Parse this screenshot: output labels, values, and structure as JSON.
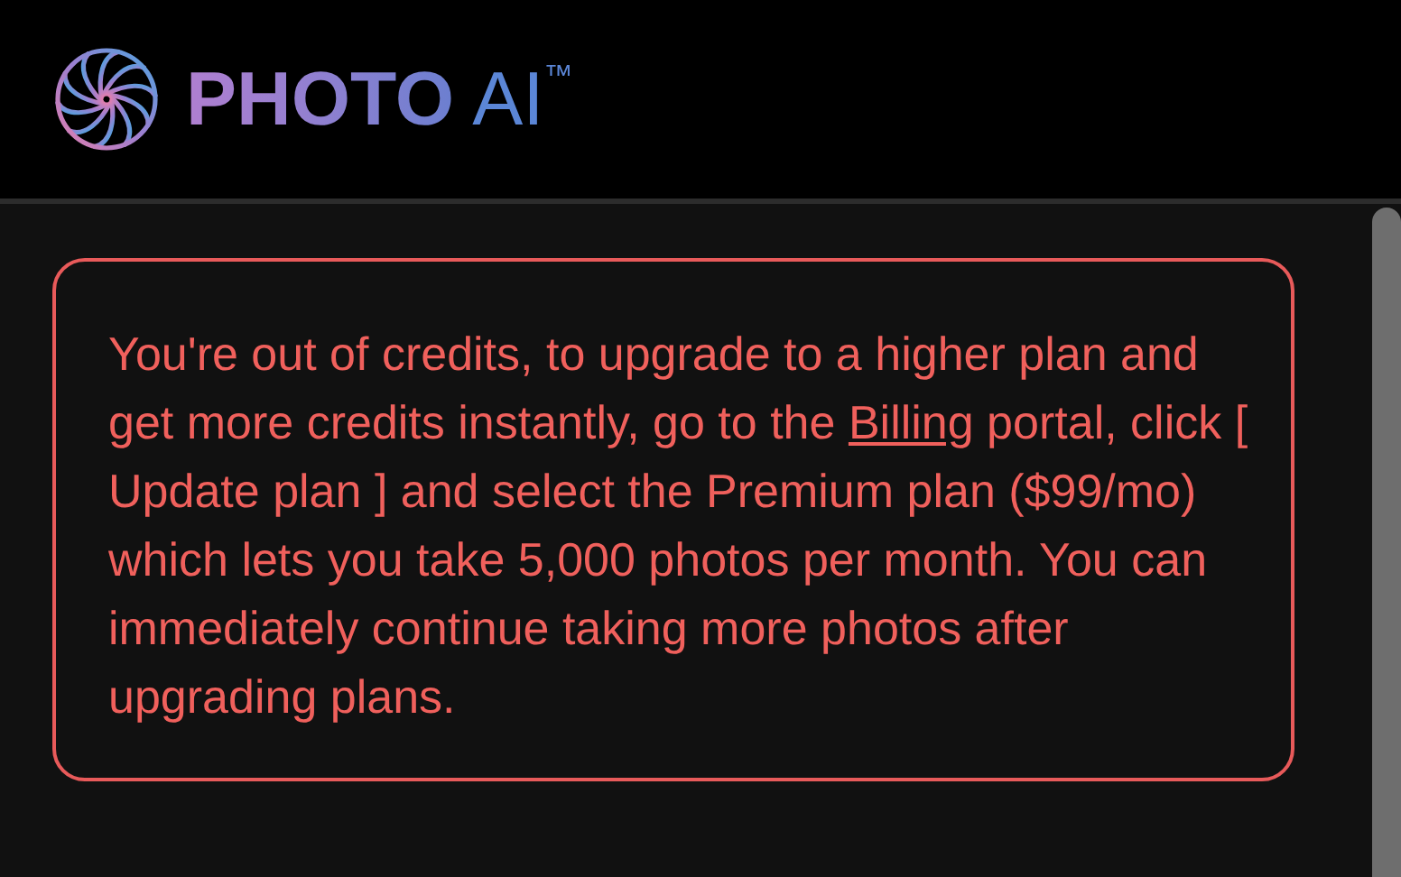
{
  "header": {
    "brand": "PHOTO",
    "brand_suffix": "AI",
    "trademark": "™"
  },
  "alert": {
    "text_before": "You're out of credits, to upgrade to a higher plan and get more credits instantly, go to the ",
    "link": "Billing",
    "text_after": " portal, click [ Update plan ] and select the Premium plan ($99/mo) which lets you take 5,000 photos per month. You can immediately continue taking more photos after upgrading plans."
  }
}
